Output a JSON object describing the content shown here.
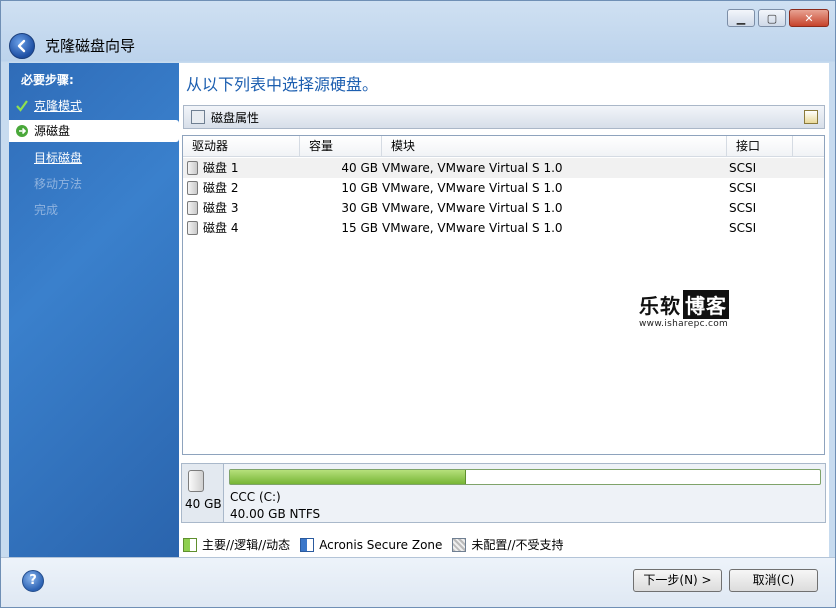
{
  "window": {
    "title": "克隆磁盘向导",
    "controls": {
      "minimize": "▁",
      "maximize": "▢",
      "close": "✕"
    }
  },
  "sidebar": {
    "heading": "必要步骤:",
    "items": [
      {
        "label": "克隆模式",
        "state": "done"
      },
      {
        "label": "源磁盘",
        "state": "active"
      },
      {
        "label": "目标磁盘",
        "state": "link"
      },
      {
        "label": "移动方法",
        "state": "disabled"
      },
      {
        "label": "完成",
        "state": "disabled"
      }
    ]
  },
  "main": {
    "heading": "从以下列表中选择源硬盘。",
    "group_label": "磁盘属性",
    "columns": [
      "驱动器",
      "容量",
      "模块",
      "接口"
    ],
    "rows": [
      {
        "drive": "磁盘 1",
        "capacity": "40 GB",
        "model": "VMware, VMware Virtual S 1.0",
        "interface": "SCSI",
        "selected": true
      },
      {
        "drive": "磁盘 2",
        "capacity": "10 GB",
        "model": "VMware, VMware Virtual S 1.0",
        "interface": "SCSI",
        "selected": false
      },
      {
        "drive": "磁盘 3",
        "capacity": "30 GB",
        "model": "VMware, VMware Virtual S 1.0",
        "interface": "SCSI",
        "selected": false
      },
      {
        "drive": "磁盘 4",
        "capacity": "15 GB",
        "model": "VMware, VMware Virtual S 1.0",
        "interface": "SCSI",
        "selected": false
      }
    ],
    "watermark": {
      "brand_a": "乐软",
      "brand_b": "博客",
      "url": "www.isharepc.com"
    }
  },
  "disk_map": {
    "size": "40 GB",
    "partition_name": "CCC (C:)",
    "partition_info": "40.00 GB  NTFS",
    "used_fraction": 0.4
  },
  "legend": [
    {
      "label": "主要//逻辑//动态",
      "swatch": "primary"
    },
    {
      "label": "Acronis Secure Zone",
      "swatch": "acronis"
    },
    {
      "label": "未配置//不受支持",
      "swatch": "unalloc"
    }
  ],
  "footer": {
    "help": "?",
    "next_label": "下一步(N) >",
    "cancel_label": "取消(C)"
  },
  "colors": {
    "accent": "#1d5fb0",
    "sidebar": "#2f6cb8",
    "partition": "#8fcf4f"
  }
}
